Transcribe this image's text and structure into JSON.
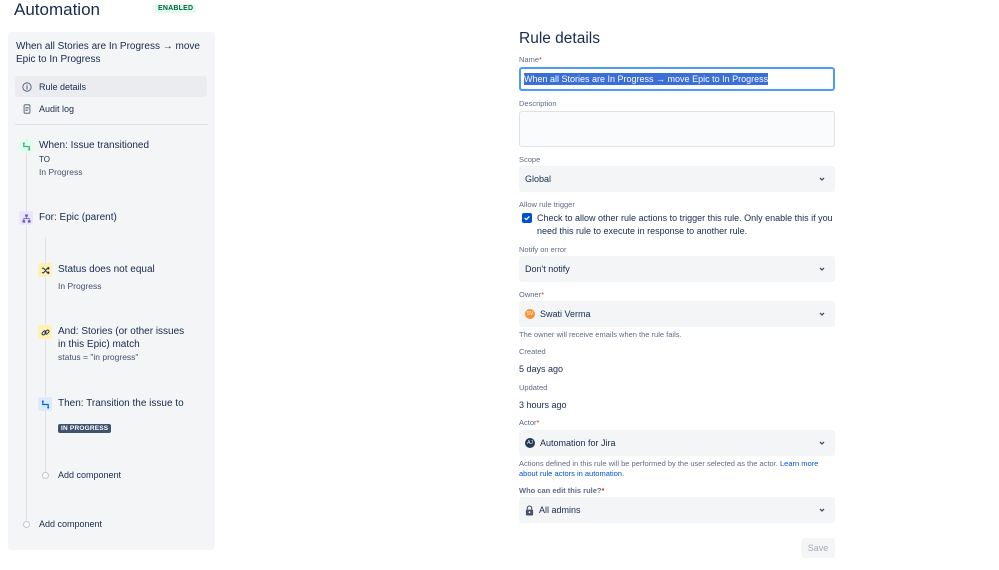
{
  "header": {
    "title": "Automation",
    "status_badge": "ENABLED"
  },
  "sidebar": {
    "rule_title": "When all Stories are In Progress → move Epic to In Progress",
    "menu": [
      {
        "label": "Rule details",
        "icon": "info-icon",
        "active": true
      },
      {
        "label": "Audit log",
        "icon": "document-icon",
        "active": false
      }
    ],
    "components": {
      "trigger": {
        "title": "When: Issue transitioned",
        "line2": "TO",
        "detail": "In Progress",
        "icon": "transition-icon",
        "color": "#36b37e"
      },
      "branch": {
        "title": "For: Epic (parent)",
        "icon": "hierarchy-icon",
        "color": "#6554c0"
      },
      "condition1": {
        "title": "Status does not equal",
        "detail": "In Progress",
        "icon": "shuffle-icon",
        "color": "#ff991f"
      },
      "condition2": {
        "title": "And: Stories (or other issues in this Epic) match",
        "detail": "status = \"in progress\"",
        "icon": "link-icon",
        "color": "#ff991f"
      },
      "action": {
        "title": "Then: Transition the issue to",
        "lozenge": "IN PROGRESS",
        "icon": "transition-icon",
        "color": "#0065ff"
      }
    },
    "add_component_inner": "Add component",
    "add_component_outer": "Add component"
  },
  "form": {
    "heading": "Rule details",
    "name": {
      "label": "Name",
      "required": "*",
      "value": "When all Stories are In Progress → move Epic to In Progress"
    },
    "description": {
      "label": "Description",
      "value": ""
    },
    "scope": {
      "label": "Scope",
      "value": "Global"
    },
    "allow_trigger": {
      "label": "Allow rule trigger",
      "checked": true,
      "text": "Check to allow other rule actions to trigger this rule. Only enable this if you need this rule to execute in response to another rule."
    },
    "notify": {
      "label": "Notify on error",
      "value": "Don't notify"
    },
    "owner": {
      "label": "Owner",
      "required": "*",
      "value": "Swati Verma",
      "avatar_initials": "SV",
      "helper": "The owner will receive emails when the rule fails."
    },
    "created": {
      "label": "Created",
      "value": "5 days ago"
    },
    "updated": {
      "label": "Updated",
      "value": "3 hours ago"
    },
    "actor": {
      "label": "Actor",
      "required": "*",
      "value": "Automation for Jira",
      "avatar_initials": "AJ",
      "helper": "Actions defined in this rule will be performed by the user selected as the actor.",
      "helper_link": "Learn more about rule actors in automation."
    },
    "who_can_edit": {
      "label": "Who can edit this rule?",
      "required": "*",
      "value": "All admins"
    },
    "save_label": "Save"
  },
  "colors": {
    "accent": "#0052cc",
    "focus": "#4c9aff",
    "enabled_bg": "#e3fcef",
    "enabled_text": "#006644"
  }
}
